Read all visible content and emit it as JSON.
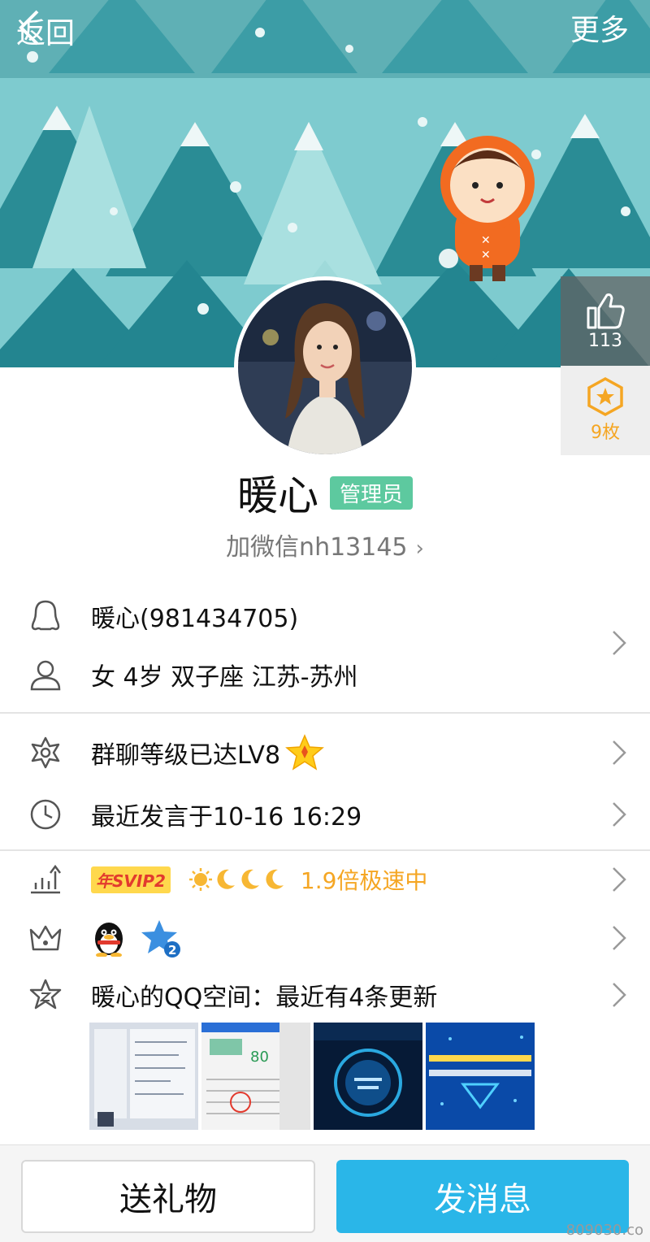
{
  "header": {
    "back_label": "返回",
    "more_label": "更多"
  },
  "side": {
    "like_count": "113",
    "badge_count": "9枚"
  },
  "profile": {
    "name": "暖心",
    "role_badge": "管理员",
    "signature": "加微信nh13145"
  },
  "info": {
    "qq": "暖心(981434705)",
    "personal": "女  4岁  双子座  江苏-苏州",
    "level": "群聊等级已达LV8",
    "last_speak": "最近发言于10-16 16:29",
    "svip_tag": "年SVIP2",
    "speed": "1.9倍极速中",
    "qzone": "暖心的QQ空间：最近有4条更新"
  },
  "actions": {
    "gift": "送礼物",
    "message": "发消息"
  },
  "footer": {
    "watermark": "809030.co"
  },
  "colors": {
    "banner": "#7ecbcf",
    "admin_badge": "#5dc99f",
    "primary_button": "#2ab6e8",
    "accent_orange": "#f5a623"
  }
}
